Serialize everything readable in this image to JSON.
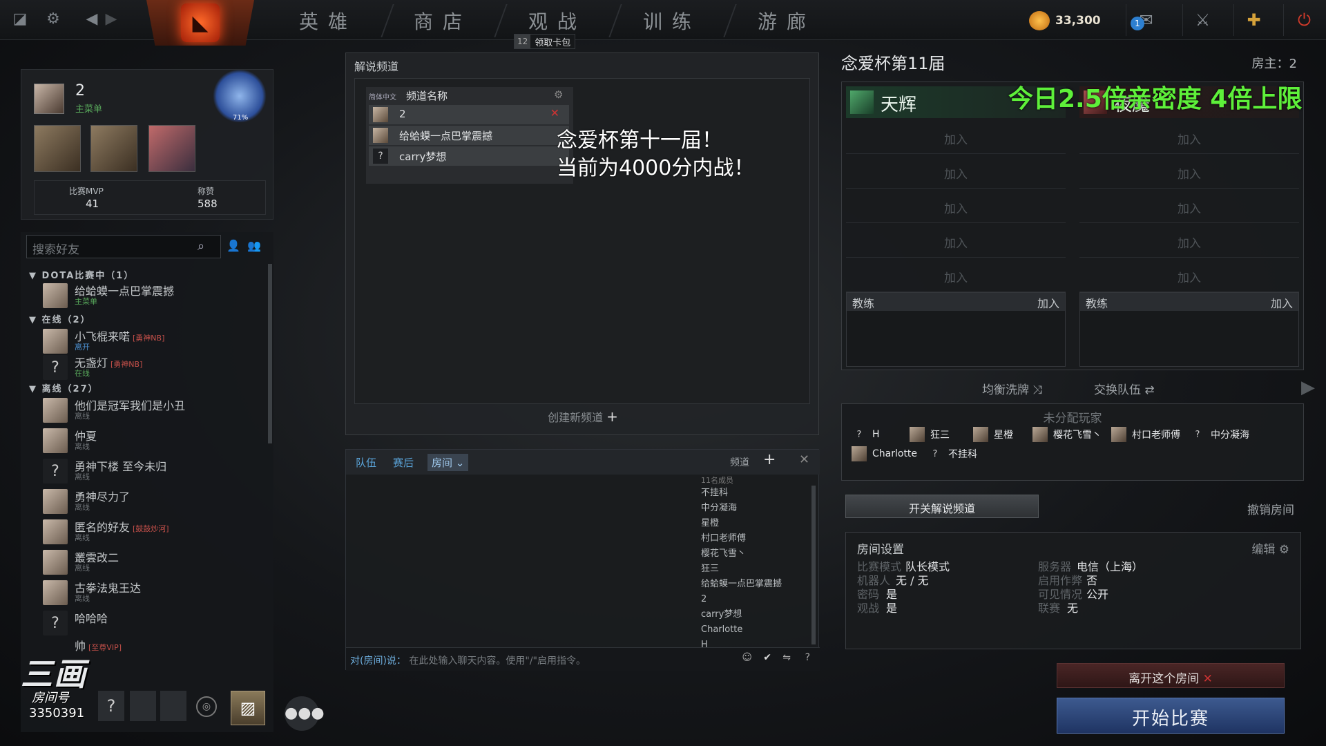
{
  "topbar": {
    "nav": [
      "英雄",
      "商店",
      "观战",
      "训练",
      "游廊"
    ],
    "reward_count": "12",
    "reward_label": "领取卡包",
    "coins": "33,300",
    "notif_badge": "1"
  },
  "profile": {
    "name": "2",
    "status": "主菜单",
    "badge_percent": "71%",
    "mvp_label": "比赛MVP",
    "mvp_value": "41",
    "praise_label": "称赞",
    "praise_value": "588"
  },
  "friends": {
    "search_placeholder": "搜索好友",
    "groups": [
      {
        "label": "DOTA比赛中（1）"
      },
      {
        "label": "在线（2）"
      },
      {
        "label": "离线（27）"
      }
    ],
    "list": [
      {
        "name": "给蛤蟆一点巴掌震撼",
        "status": "主菜单",
        "tag": ""
      },
      {
        "name": "小飞棍来喏",
        "status": "离开",
        "tag": "[勇神NB]"
      },
      {
        "name": "无盏灯",
        "status": "在线",
        "tag": "[勇神NB]"
      },
      {
        "name": "他们是冠军我们是小丑",
        "status": "离线",
        "tag": ""
      },
      {
        "name": "仲夏",
        "status": "离线",
        "tag": ""
      },
      {
        "name": "勇神下楼 至今未归",
        "status": "离线",
        "tag": ""
      },
      {
        "name": "勇神尽力了",
        "status": "离线",
        "tag": ""
      },
      {
        "name": "匿名的好友",
        "status": "离线",
        "tag": "[鼓鼓炒河]"
      },
      {
        "name": "叢雲改二",
        "status": "离线",
        "tag": ""
      },
      {
        "name": "古拳法鬼王达",
        "status": "离线",
        "tag": ""
      },
      {
        "name": "哈哈哈",
        "status": "",
        "tag": ""
      },
      {
        "name": "帅",
        "status": "",
        "tag": "[至尊VIP]"
      }
    ]
  },
  "watermark": {
    "logo": "三画",
    "room_label": "房间号",
    "room_id": "3350391"
  },
  "cast": {
    "title": "解说频道",
    "lang": "简体中文",
    "col_name": "频道名称",
    "rows": [
      "2",
      "给蛤蟆一点巴掌震撼",
      "carry梦想"
    ],
    "announce_line1": "念爱杯第十一届！",
    "announce_line2": "当前为4000分内战！",
    "create": "创建新频道"
  },
  "chat": {
    "tabs": [
      "队伍",
      "赛后",
      "房间"
    ],
    "channel_label": "频道",
    "member_count": "11名成员",
    "members": [
      "不挂科",
      "中分凝海",
      "星橙",
      "村口老师傅",
      "樱花飞雪丶",
      "狂三",
      "给蛤蟆一点巴掌震撼",
      "2",
      "carry梦想",
      "Charlotte",
      "H"
    ],
    "input_prefix": "对(房间)说：",
    "input_placeholder": "在此处输入聊天内容。使用\"/\"启用指令。"
  },
  "lobby": {
    "title": "念爱杯第11届",
    "host": "房主：2",
    "radiant": "天辉",
    "dire": "夜魇",
    "join": "加入",
    "coach": "教练",
    "overlay": "今日2.5倍亲密度 4倍上限",
    "balance": "均衡洗牌",
    "swap": "交换队伍",
    "unassigned_title": "未分配玩家",
    "unassigned": [
      {
        "name": "H",
        "q": true
      },
      {
        "name": "狂三",
        "q": false
      },
      {
        "name": "星橙",
        "q": false
      },
      {
        "name": "樱花飞雪丶",
        "q": false
      },
      {
        "name": "村口老师傅",
        "q": false
      },
      {
        "name": "中分凝海",
        "q": true
      },
      {
        "name": "Charlotte",
        "q": false
      },
      {
        "name": "不挂科",
        "q": true
      }
    ],
    "cast_toggle": "开关解说频道",
    "disband": "撤销房间",
    "settings_title": "房间设置",
    "edit": "编辑",
    "settings": [
      {
        "k": "比赛模式",
        "v": "队长模式"
      },
      {
        "k": "机器人",
        "v": "无 / 无"
      },
      {
        "k": "密码",
        "v": "是"
      },
      {
        "k": "观战",
        "v": "是"
      },
      {
        "k": "服务器",
        "v": "电信（上海）"
      },
      {
        "k": "启用作弊",
        "v": "否"
      },
      {
        "k": "可见情况",
        "v": "公开"
      },
      {
        "k": "联赛",
        "v": "无"
      }
    ],
    "leave": "离开这个房间",
    "start": "开始比赛"
  }
}
